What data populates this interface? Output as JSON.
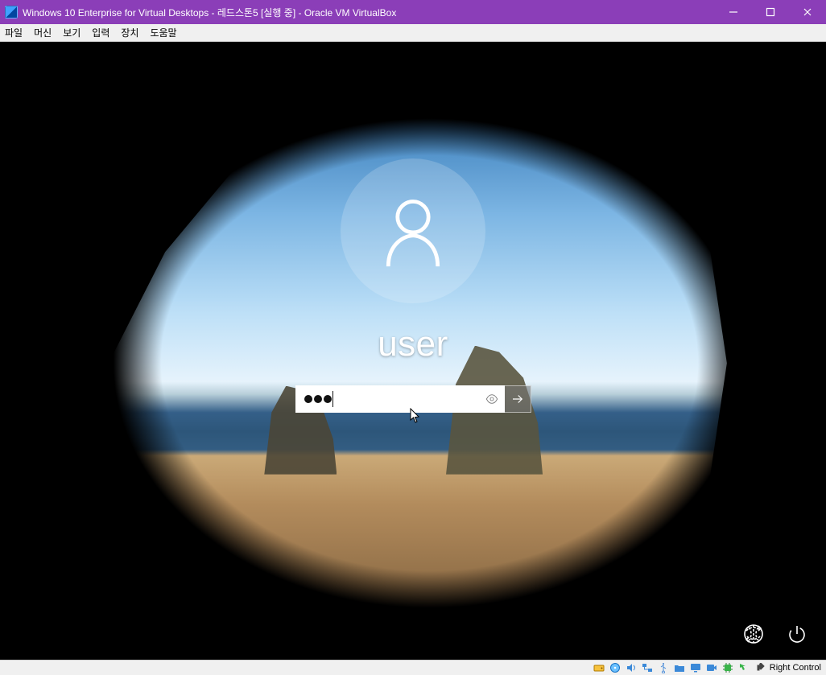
{
  "window": {
    "title": "Windows 10 Enterprise for Virtual Desktops - 레드스톤5 [실행 중] - Oracle VM VirtualBox"
  },
  "menu": {
    "file": "파일",
    "machine": "머신",
    "view": "보기",
    "input": "입력",
    "devices": "장치",
    "help": "도움말"
  },
  "login": {
    "username": "user",
    "password_masked_len": 3,
    "reveal_tooltip": "Reveal password",
    "submit_tooltip": "Submit"
  },
  "lock_controls": {
    "network": "Network",
    "power": "Power"
  },
  "statusbar": {
    "host_key": "Right Control",
    "icons": {
      "hdd": "hard-disk-icon",
      "cd": "optical-drive-icon",
      "net": "network-icon",
      "usb": "usb-icon",
      "shared": "shared-folder-icon",
      "display": "display-icon",
      "record": "recording-icon",
      "cpu": "cpu-icon",
      "mouse": "mouse-integration-icon",
      "kbd": "keyboard-capture-icon"
    }
  }
}
